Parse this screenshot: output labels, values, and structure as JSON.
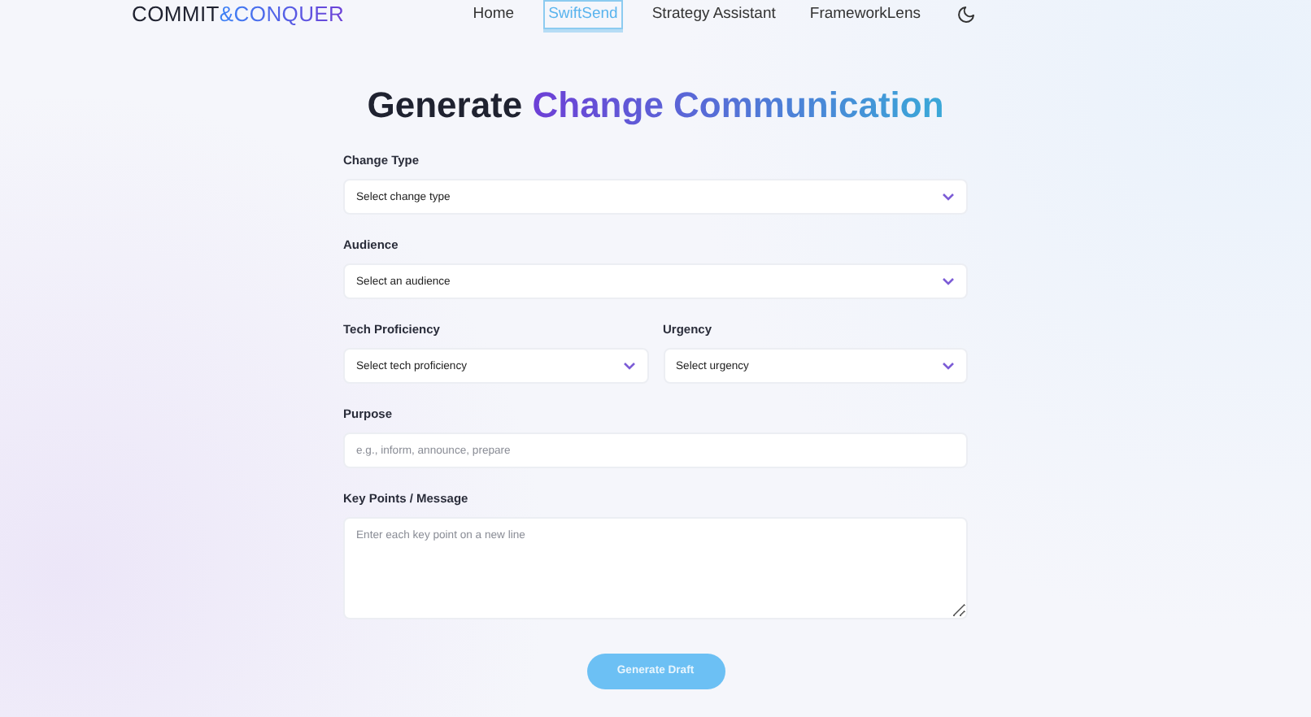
{
  "logo": {
    "first": "COMMIT",
    "second": "&CONQUER"
  },
  "nav": [
    {
      "label": "Home",
      "selected": false
    },
    {
      "label": "SwiftSend",
      "selected": true
    },
    {
      "label": "Strategy Assistant",
      "selected": false
    },
    {
      "label": "FrameworkLens",
      "selected": false
    }
  ],
  "title": {
    "plain": "Generate",
    "highlight": "Change Communication"
  },
  "form_rows": [
    [
      {
        "kind": "select",
        "label": "Change Type",
        "value": "Select change type"
      }
    ],
    [
      {
        "kind": "select",
        "label": "Audience",
        "value": "Select an audience"
      }
    ],
    [
      {
        "kind": "select",
        "label": "Tech Proficiency",
        "value": "Select tech proficiency"
      },
      {
        "kind": "select",
        "label": "Urgency",
        "value": "Select urgency"
      }
    ],
    [
      {
        "kind": "input",
        "label": "Purpose",
        "placeholder": "e.g., inform, announce, prepare"
      }
    ],
    [
      {
        "kind": "textarea",
        "label": "Key Points / Message",
        "placeholder": "Enter each key point on a new line"
      }
    ]
  ],
  "submit": {
    "label": "Generate Draft",
    "disabled": true
  }
}
